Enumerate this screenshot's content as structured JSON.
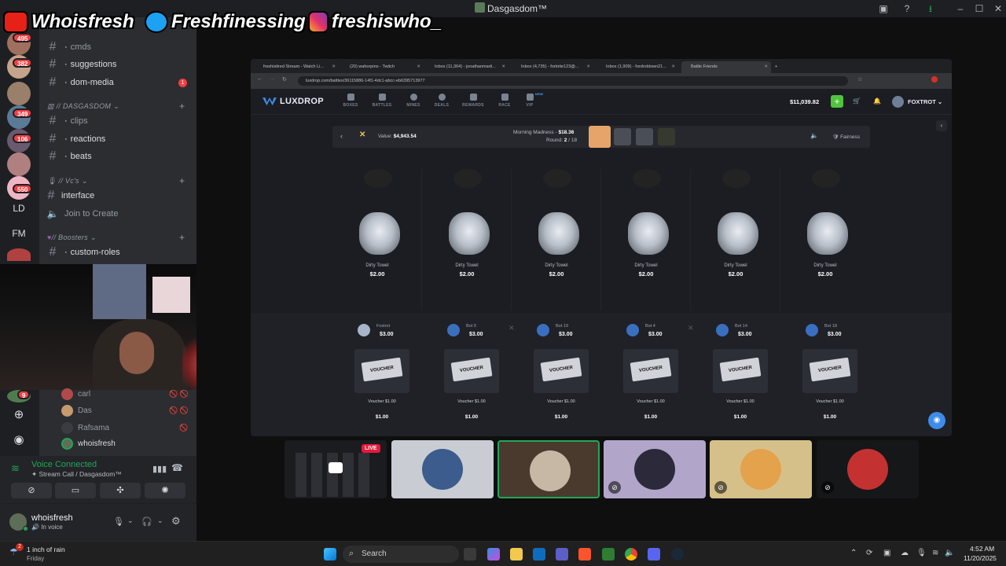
{
  "window": {
    "title": "Dasgasdom™"
  },
  "overlay": {
    "youtube": "Whoisfresh",
    "twitter": "Freshfinessing",
    "instagram": "freshiswho_"
  },
  "rail": {
    "badges": [
      "495",
      "382",
      "349",
      "106",
      "550"
    ],
    "text_items": [
      "LD",
      "FM"
    ],
    "badge_bottom": "9"
  },
  "channels": {
    "items": [
      {
        "name": "cmds"
      },
      {
        "name": "suggestions"
      },
      {
        "name": "dom-media",
        "unread": "1"
      }
    ],
    "cat1": "// DASGASDOM",
    "items2": [
      {
        "name": "clips"
      },
      {
        "name": "reactions"
      },
      {
        "name": "beats"
      }
    ],
    "cat2": "// Vc's",
    "items3": [
      {
        "name": "interface"
      },
      {
        "name": "Join to Create"
      }
    ],
    "cat3": "// Boosters",
    "items4": [
      {
        "name": "custom-roles"
      }
    ]
  },
  "voice_members": [
    {
      "name": "carl"
    },
    {
      "name": "Das"
    },
    {
      "name": "Rafsama"
    },
    {
      "name": "whoisfresh"
    }
  ],
  "voice": {
    "status": "Voice Connected",
    "channel": "Stream Call / Dasgasdom™"
  },
  "user": {
    "name": "whoisfresh",
    "status": "In voice"
  },
  "browser": {
    "tabs": [
      "freshistired Stream - Watch Li...",
      "(20) wahorpino - Twitch",
      "Inbox (11,364) - jonathanmarti...",
      "Inbox (4,735) - fortnite123@...",
      "Inbox (1,909) - fordroldown21...",
      "Battle Friends"
    ],
    "url": "luxdrop.com/battles/36115886-14f1-4dc1-abcc-eb6395713977"
  },
  "site": {
    "logo": "LUXDROP",
    "nav": [
      "BOXES",
      "BATTLES",
      "MINES",
      "DEALS",
      "REWARDS",
      "RACE",
      "VIP"
    ],
    "new_label": "NEW",
    "balance": "$11,039.82",
    "username": "FOXTROT"
  },
  "battle": {
    "value_label": "Value:",
    "value": "$4,943.54",
    "case_name": "Morning Madness",
    "case_price": "$18.36",
    "round_label": "Round:",
    "round": "2",
    "round_total": "/ 18",
    "fairness": "Fairness"
  },
  "reel": [
    {
      "name": "Dirty Towel",
      "price": "$2.00"
    },
    {
      "name": "Dirty Towel",
      "price": "$2.00"
    },
    {
      "name": "Dirty Towel",
      "price": "$2.00"
    },
    {
      "name": "Dirty Towel",
      "price": "$2.00"
    },
    {
      "name": "Dirty Towel",
      "price": "$2.00"
    },
    {
      "name": "Dirty Towel",
      "price": "$2.00"
    }
  ],
  "players": [
    {
      "name": "Foxtrot",
      "total": "$3.00",
      "item": "Voucher $1.00",
      "price": "$1.00"
    },
    {
      "name": "Bot 9",
      "total": "$3.00",
      "item": "Voucher $1.00",
      "price": "$1.00"
    },
    {
      "name": "Bot 19",
      "total": "$3.00",
      "item": "Voucher $1.00",
      "price": "$1.00"
    },
    {
      "name": "Bot 4",
      "total": "$3.00",
      "item": "Voucher $1.00",
      "price": "$1.00"
    },
    {
      "name": "Bot 14",
      "total": "$3.00",
      "item": "Voucher $1.00",
      "price": "$1.00"
    },
    {
      "name": "Bot 18",
      "total": "$3.00",
      "item": "Voucher $1.00",
      "price": "$1.00"
    }
  ],
  "voucher_label": "VOUCHER",
  "stream": {
    "live": "LIVE"
  },
  "taskbar": {
    "weather": "1 inch of rain",
    "weather_sub": "Friday",
    "weather_badge": "2",
    "search": "Search",
    "time": "4:52 AM",
    "date": "11/20/2025"
  },
  "colors": {
    "accent": "#3d8ce8",
    "green": "#4fc43c",
    "voice_green": "#23a559",
    "live": "#e8193c"
  }
}
